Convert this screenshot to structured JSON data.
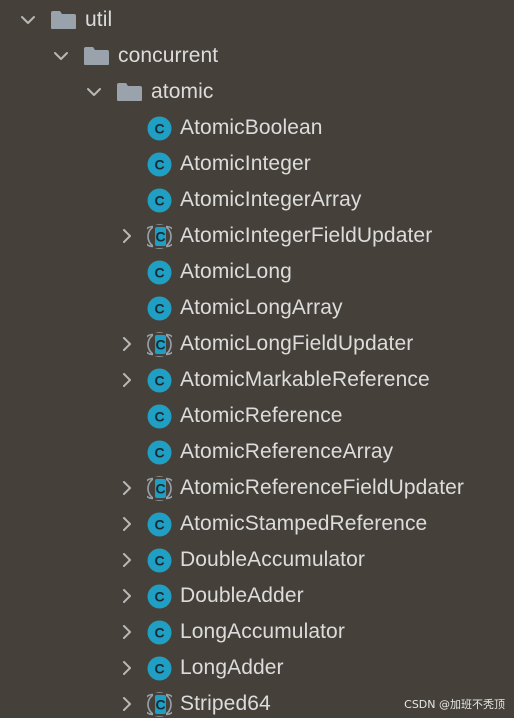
{
  "colors": {
    "background": "#45413a",
    "text": "#dcdcdc",
    "chevron": "#b8b8b8",
    "folder": "#9aa3ab",
    "class_badge": "#1f9fc3",
    "class_letter": "#1a2b33",
    "abstract_outline": "#9aa3ab"
  },
  "tree": [
    {
      "label": "util",
      "type": "folder",
      "depth": 0,
      "expandable": true,
      "expanded": true,
      "icon": "folder-icon"
    },
    {
      "label": "concurrent",
      "type": "folder",
      "depth": 1,
      "expandable": true,
      "expanded": true,
      "icon": "folder-icon"
    },
    {
      "label": "atomic",
      "type": "folder",
      "depth": 2,
      "expandable": true,
      "expanded": true,
      "icon": "folder-icon"
    },
    {
      "label": "AtomicBoolean",
      "type": "class",
      "depth": 3,
      "expandable": false,
      "icon": "class-icon"
    },
    {
      "label": "AtomicInteger",
      "type": "class",
      "depth": 3,
      "expandable": false,
      "icon": "class-icon"
    },
    {
      "label": "AtomicIntegerArray",
      "type": "class",
      "depth": 3,
      "expandable": false,
      "icon": "class-icon"
    },
    {
      "label": "AtomicIntegerFieldUpdater",
      "type": "abstract-class",
      "depth": 3,
      "expandable": true,
      "expanded": false,
      "icon": "abstract-class-icon"
    },
    {
      "label": "AtomicLong",
      "type": "class",
      "depth": 3,
      "expandable": false,
      "icon": "class-icon"
    },
    {
      "label": "AtomicLongArray",
      "type": "class",
      "depth": 3,
      "expandable": false,
      "icon": "class-icon"
    },
    {
      "label": "AtomicLongFieldUpdater",
      "type": "abstract-class",
      "depth": 3,
      "expandable": true,
      "expanded": false,
      "icon": "abstract-class-icon"
    },
    {
      "label": "AtomicMarkableReference",
      "type": "class",
      "depth": 3,
      "expandable": true,
      "expanded": false,
      "icon": "class-icon"
    },
    {
      "label": "AtomicReference",
      "type": "class",
      "depth": 3,
      "expandable": false,
      "icon": "class-icon"
    },
    {
      "label": "AtomicReferenceArray",
      "type": "class",
      "depth": 3,
      "expandable": false,
      "icon": "class-icon"
    },
    {
      "label": "AtomicReferenceFieldUpdater",
      "type": "abstract-class",
      "depth": 3,
      "expandable": true,
      "expanded": false,
      "icon": "abstract-class-icon"
    },
    {
      "label": "AtomicStampedReference",
      "type": "class",
      "depth": 3,
      "expandable": true,
      "expanded": false,
      "icon": "class-icon"
    },
    {
      "label": "DoubleAccumulator",
      "type": "class",
      "depth": 3,
      "expandable": true,
      "expanded": false,
      "icon": "class-icon"
    },
    {
      "label": "DoubleAdder",
      "type": "class",
      "depth": 3,
      "expandable": true,
      "expanded": false,
      "icon": "class-icon"
    },
    {
      "label": "LongAccumulator",
      "type": "class",
      "depth": 3,
      "expandable": true,
      "expanded": false,
      "icon": "class-icon"
    },
    {
      "label": "LongAdder",
      "type": "class",
      "depth": 3,
      "expandable": true,
      "expanded": false,
      "icon": "class-icon"
    },
    {
      "label": "Striped64",
      "type": "abstract-class",
      "depth": 3,
      "expandable": true,
      "expanded": false,
      "icon": "abstract-class-icon"
    }
  ],
  "class_badge_letter": "C",
  "watermark": "CSDN @加班不秃顶"
}
